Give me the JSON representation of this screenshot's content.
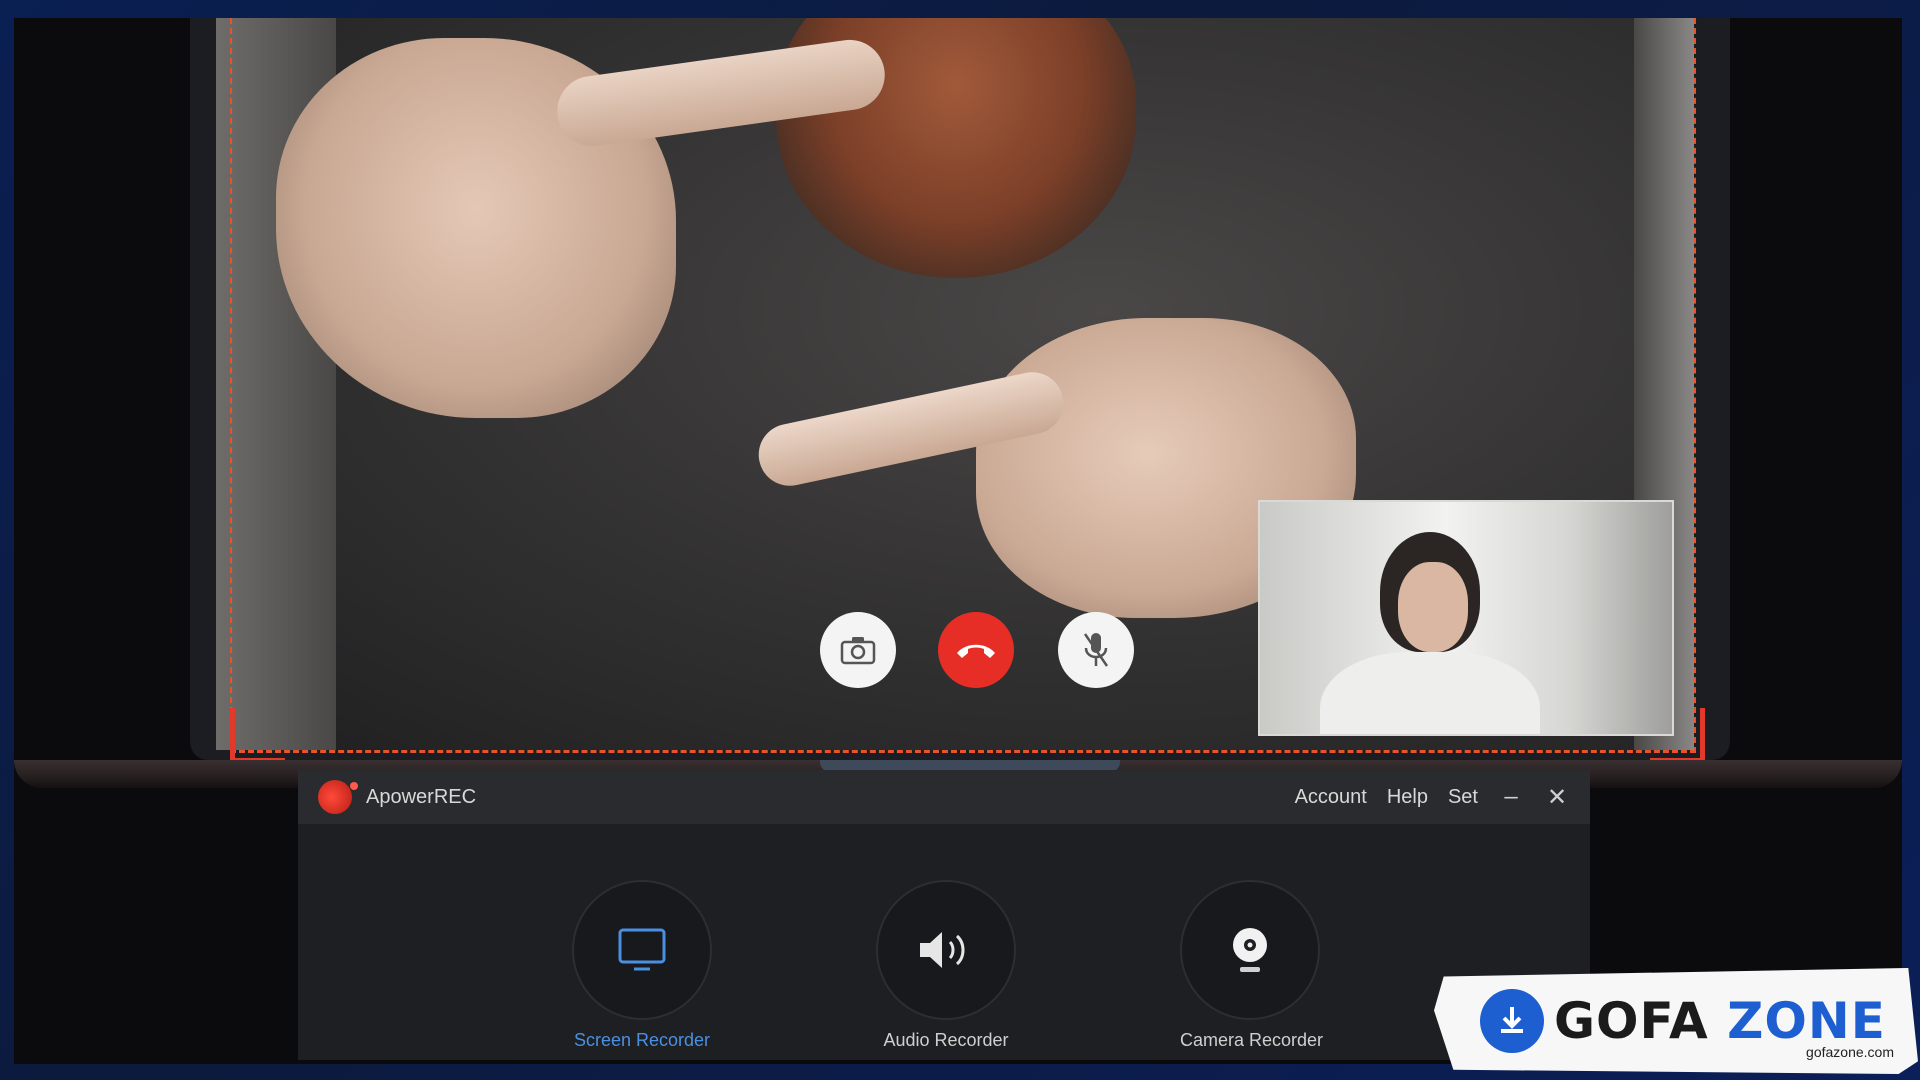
{
  "app": {
    "title": "ApowerREC",
    "menu": {
      "account": "Account",
      "help": "Help",
      "set": "Set"
    },
    "window_controls": {
      "minimize": "–",
      "close": "✕"
    }
  },
  "modes": [
    {
      "label": "Screen Recorder",
      "icon": "monitor-icon",
      "active": true
    },
    {
      "label": "Audio Recorder",
      "icon": "speaker-icon",
      "active": false
    },
    {
      "label": "Camera Recorder",
      "icon": "webcam-icon",
      "active": false
    }
  ],
  "call_controls": [
    "camera-icon",
    "hang-up-icon",
    "mute-mic-icon"
  ],
  "watermark": {
    "brand": "GOFA",
    "brand2": "ZONE",
    "domain": "gofazone.com"
  },
  "colors": {
    "record_frame": "#e8542a",
    "hangup": "#e62e26",
    "accent": "#4a90e2"
  }
}
